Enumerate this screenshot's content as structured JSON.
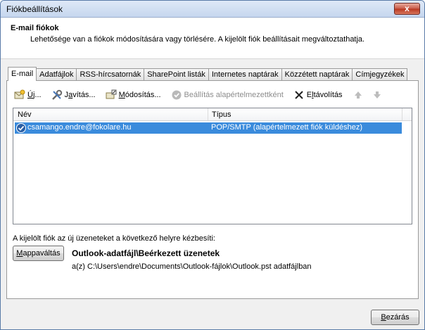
{
  "window": {
    "title": "Fiókbeállítások",
    "close_glyph": "x"
  },
  "header": {
    "title": "E-mail fiókok",
    "description": "Lehetősége van a fiókok módosítására vagy törlésére. A kijelölt fiók beállításait megváltoztathatja."
  },
  "tabs": [
    {
      "label": "E-mail",
      "active": true
    },
    {
      "label": "Adatfájlok"
    },
    {
      "label": "RSS-hírcsatornák"
    },
    {
      "label": "SharePoint listák"
    },
    {
      "label": "Internetes naptárak"
    },
    {
      "label": "Közzétett naptárak"
    },
    {
      "label": "Címjegyzékek"
    }
  ],
  "toolbar": {
    "new_u": "Ú",
    "new_rest": "j...",
    "repair_pre": "J",
    "repair_u": "a",
    "repair_rest": "vítás...",
    "change_u": "M",
    "change_rest": "ódosítás...",
    "default_label": "Beállítás alapértelmezettként",
    "remove_pre": "E",
    "remove_u": "l",
    "remove_rest": "távolítás"
  },
  "list": {
    "col_name": "Név",
    "col_type": "Típus",
    "rows": [
      {
        "name": "csamango.endre@fokolare.hu",
        "type": "POP/SMTP (alapértelmezett fiók küldéshez)",
        "selected": true
      }
    ]
  },
  "delivery": {
    "label": "A kijelölt fiók az új üzeneteket a következő helyre kézbesíti:",
    "button_pre": "",
    "button_u": "M",
    "button_rest": "appaváltás",
    "folder": "Outlook-adatfájl\\Beérkezett üzenetek",
    "path": "a(z) C:\\Users\\endre\\Documents\\Outlook-fájlok\\Outlook.pst adatfájlban"
  },
  "footer": {
    "close_label": "Bezárás",
    "close_u": "B",
    "close_rest": "ezárás"
  },
  "colors": {
    "selection": "#3a8bdc",
    "close_red": "#c85a48"
  }
}
